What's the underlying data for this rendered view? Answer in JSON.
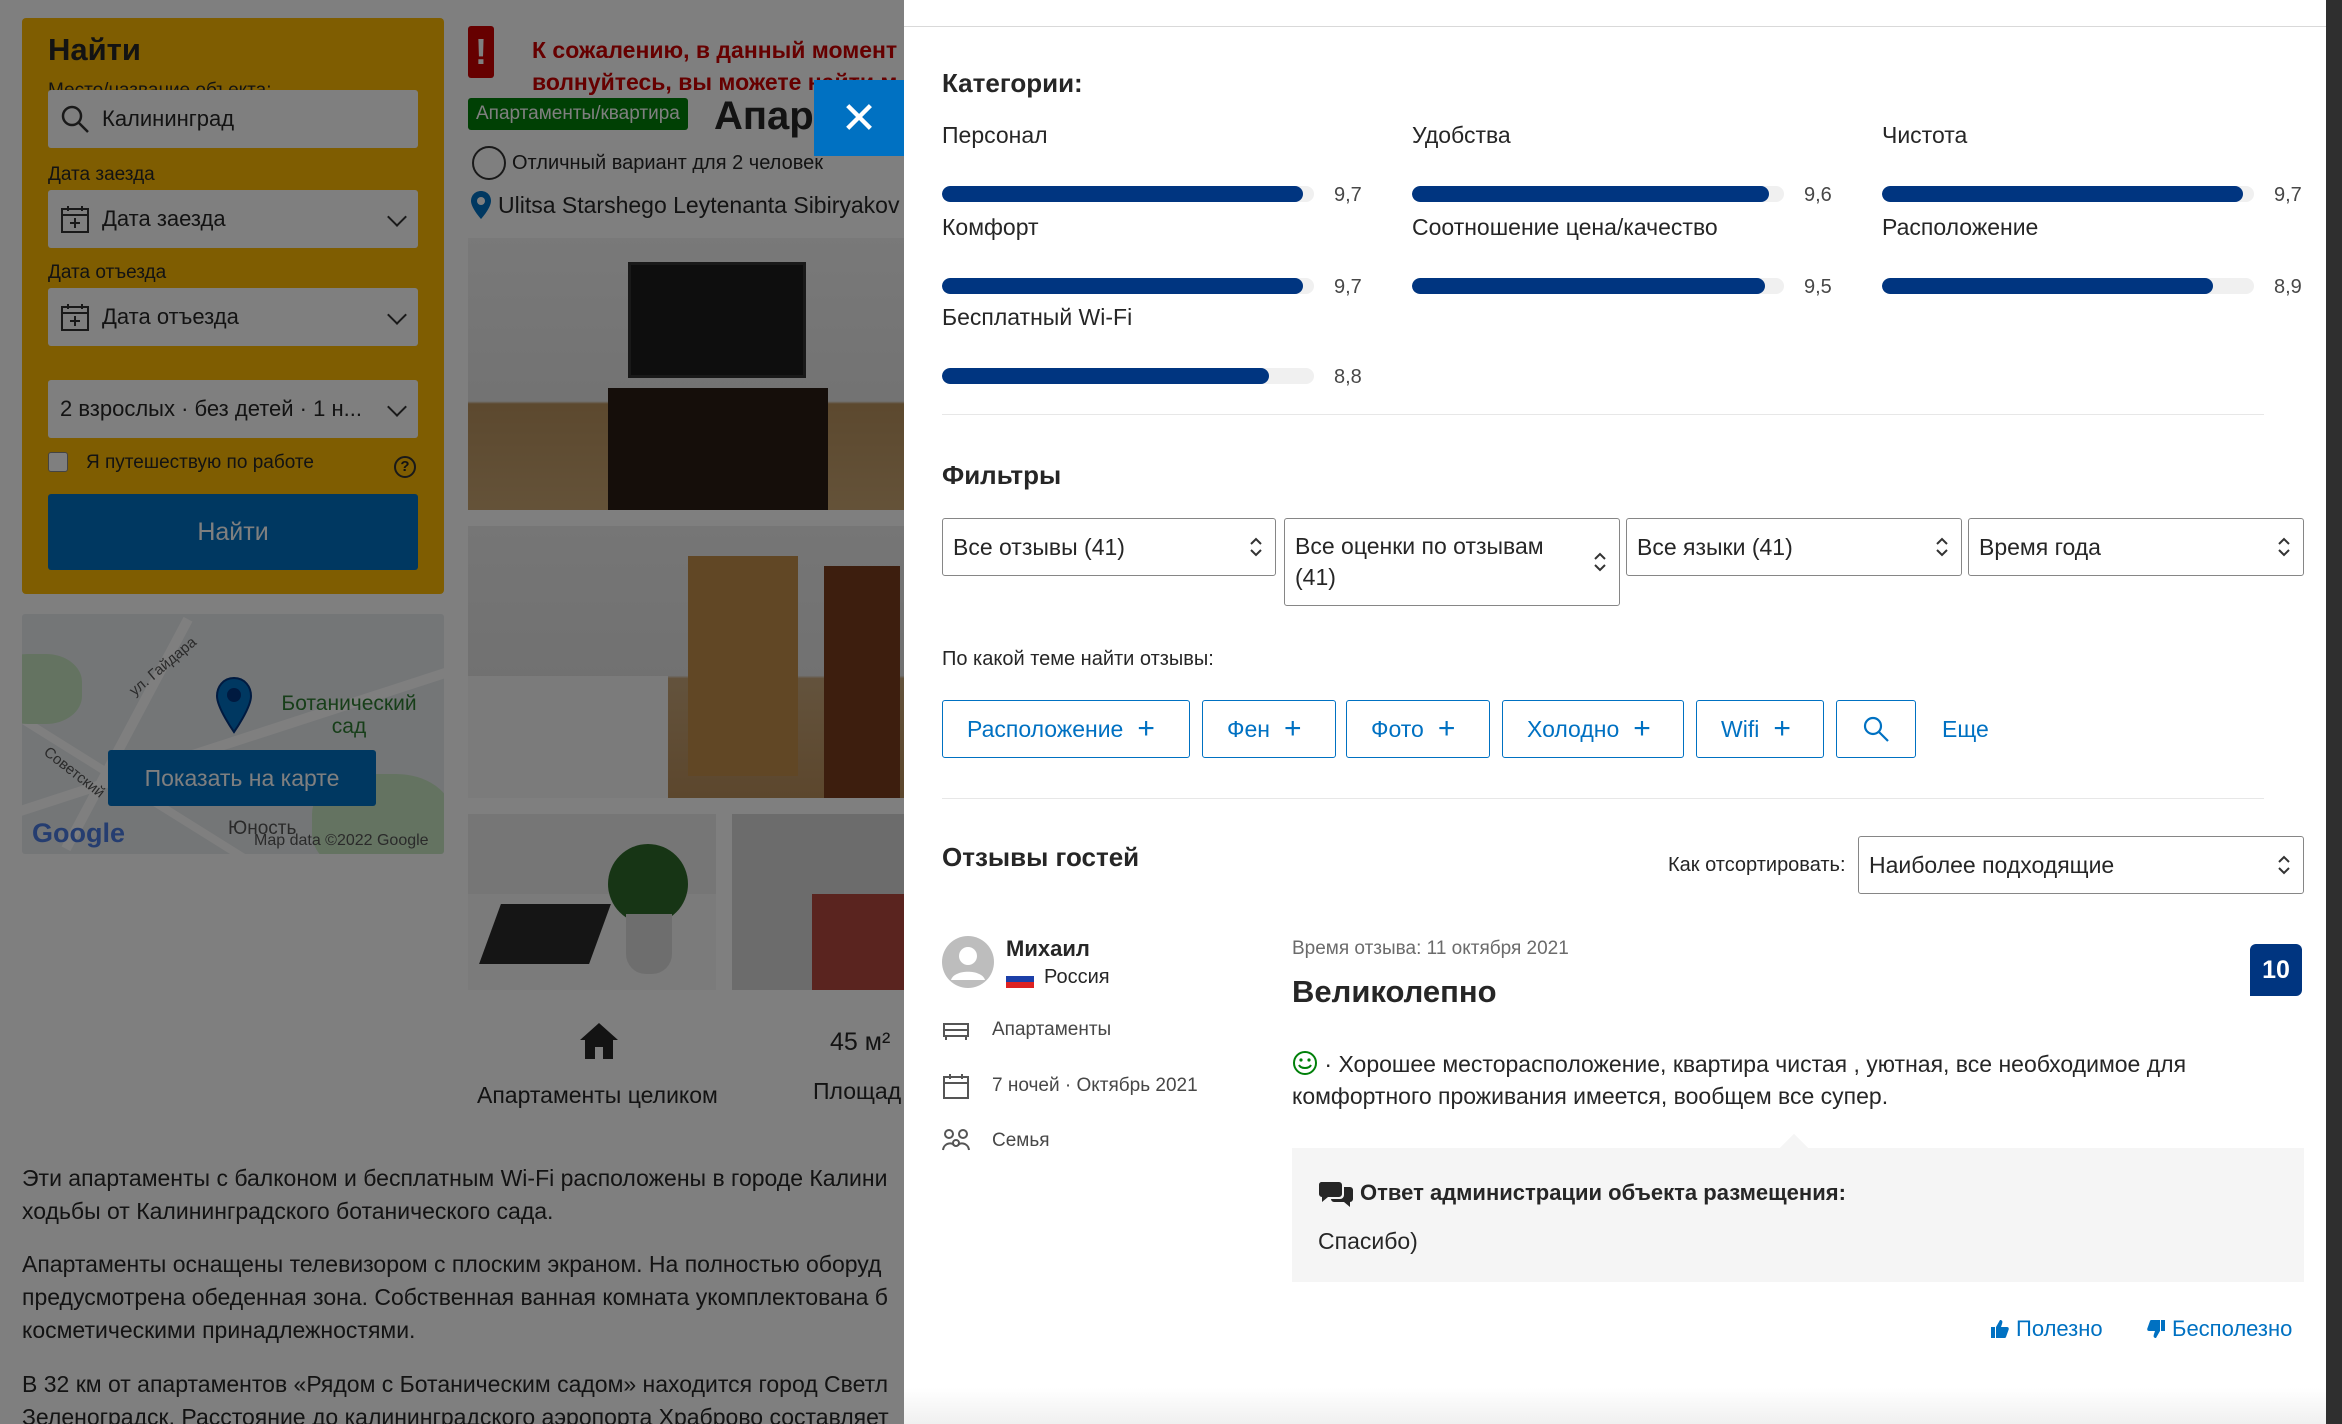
{
  "search": {
    "title": "Найти",
    "destination_label": "Место/название объекта:",
    "destination_value": "Калининград",
    "checkin_label": "Дата заезда",
    "checkin_value": "Дата заезда",
    "checkout_label": "Дата отъезда",
    "checkout_value": "Дата отъезда",
    "guests_value": "2 взрослых · без детей · 1 н...",
    "work_trip_label": "Я путешествую по работе",
    "help_glyph": "?",
    "submit_label": "Найти"
  },
  "map": {
    "label_garden": "Ботанический сад",
    "street1": "ул. Гайдара",
    "street2": "Советский",
    "street3": "Юность",
    "show_button": "Показать на карте",
    "google": "Google",
    "attribution": "Map data ©2022 Google"
  },
  "property": {
    "notice_icon": "!",
    "notice_line1": "К сожалению, в данный момент",
    "notice_line2": "волнуйтесь, вы можете найти м",
    "type_badge": "Апартаменты/квартира",
    "title": "Апар",
    "feature1": "Отличный вариант для 2 человек",
    "address": "Ulitsa Starshego Leytenanta Sibiryakov",
    "amenity1_label": "Апартаменты целиком",
    "amenity2_value": "45 м²",
    "amenity2_label": "Площад",
    "desc1_line1": "Эти апартаменты с балконом и бесплатным Wi-Fi расположены в городе Калини",
    "desc1_line2": "ходьбы от Калининградского ботанического сада.",
    "desc2_line1": "Апартаменты оснащены телевизором с плоским экраном. На полностью оборуд",
    "desc2_line2": "предусмотрена обеденная зона. Собственная ванная комната укомплектована б",
    "desc2_line3": "косметическими принадлежностями.",
    "desc3_line1": "В 32 км от апартаментов «Рядом с Ботаническим садом» находится город Светл",
    "desc3_line2": "Зеленоградск. Расстояние до калининградского аэропорта Храброво составляет"
  },
  "panel": {
    "close_glyph": "✕",
    "categories_title": "Категории:",
    "categories": [
      {
        "name": "Персонал",
        "score": "9,7",
        "value": 9.7
      },
      {
        "name": "Удобства",
        "score": "9,6",
        "value": 9.6
      },
      {
        "name": "Чистота",
        "score": "9,7",
        "value": 9.7
      },
      {
        "name": "Комфорт",
        "score": "9,7",
        "value": 9.7
      },
      {
        "name": "Соотношение цена/качество",
        "score": "9,5",
        "value": 9.5
      },
      {
        "name": "Расположение",
        "score": "8,9",
        "value": 8.9
      },
      {
        "name": "Бесплатный Wi-Fi",
        "score": "8,8",
        "value": 8.8
      }
    ],
    "filters_title": "Фильтры",
    "filters": {
      "reviews": "Все отзывы (41)",
      "scores_line1": "Все оценки по отзывам",
      "scores_line2": "(41)",
      "languages": "Все языки (41)",
      "season": "Время года"
    },
    "topic_label": "По какой теме найти отзывы:",
    "topics": [
      "Расположение",
      "Фен",
      "Фото",
      "Холодно",
      "Wifi"
    ],
    "topic_plus": "+",
    "more_label": "Еще",
    "guest_reviews_title": "Отзывы гостей",
    "sort_label": "Как отсортировать:",
    "sort_value": "Наиболее подходящие"
  },
  "review": {
    "author": "Михаил",
    "country": "Россия",
    "room_type": "Апартаменты",
    "stay": "7 ночей · Октябрь 2021",
    "traveler_type": "Семья",
    "date": "Время отзыва: 11 октября 2021",
    "title": "Великолепно",
    "score": "10",
    "text_line1": " · Хорошее месторасположение, квартира чистая , уютная, все необходимое для",
    "text_line2": "комфортного проживания имеется, вообщем все супер.",
    "response_title": "Ответ администрации объекта размещения:",
    "response_text": "Спасибо)",
    "helpful": "Полезно",
    "not_helpful": "Бесполезно"
  },
  "colors": {
    "brand_blue": "#0071c2",
    "score_navy": "#003580",
    "search_yellow": "#febb02",
    "alert_red": "#cc0000",
    "badge_green": "#008009"
  }
}
